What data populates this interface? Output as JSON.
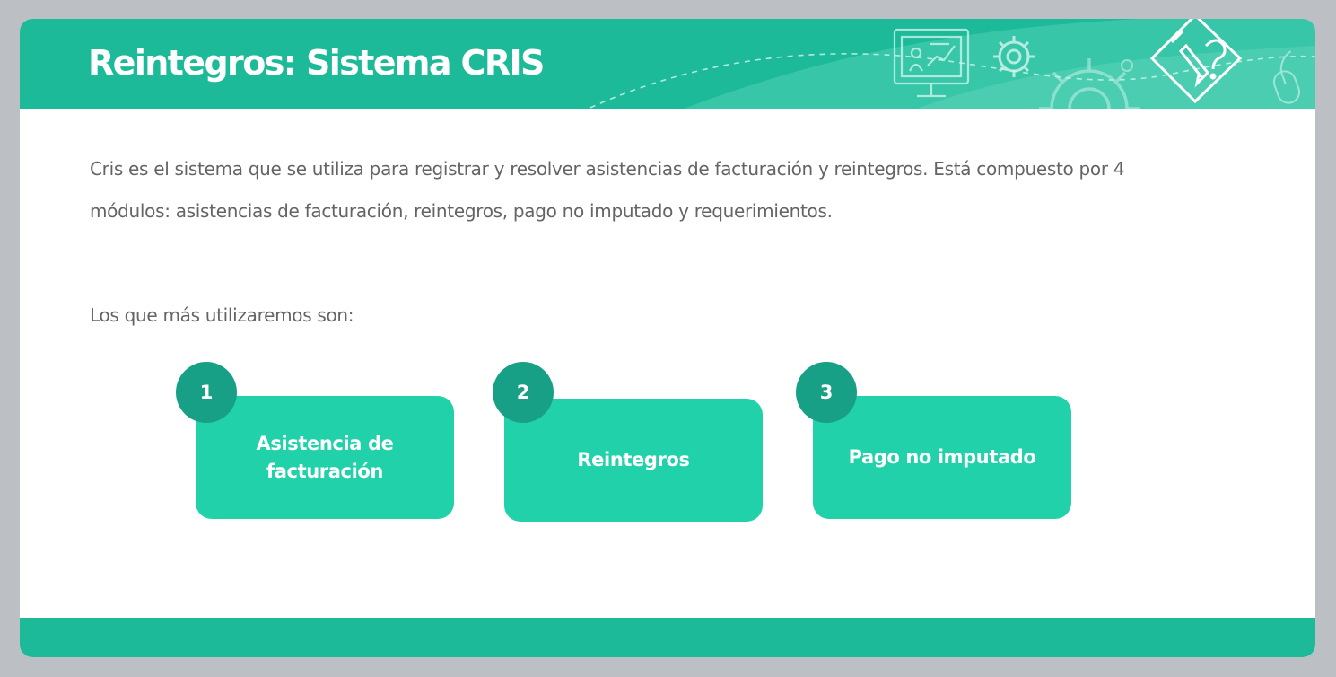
{
  "header": {
    "title": "Reintegros: Sistema CRIS"
  },
  "main": {
    "intro": "Cris es el sistema que se utiliza para registrar y resolver asistencias de facturación y reintegros. Está compuesto por 4 módulos: asistencias de facturación, reintegros, pago no imputado y requerimientos.",
    "subheading": "Los que más utilizaremos son:",
    "modules": [
      {
        "number": "1",
        "label": "Asistencia de facturación"
      },
      {
        "number": "2",
        "label": "Reintegros"
      },
      {
        "number": "3",
        "label": "Pago no imputado"
      }
    ]
  },
  "colors": {
    "background": "#bcc0c4",
    "header": "#1dba99",
    "module_box": "#20d1aa",
    "badge": "#17a085",
    "body_text": "#646464"
  },
  "icons": [
    "presentation-board-icon",
    "gear-icon",
    "large-gear-icon",
    "edit-diamond-icon",
    "mouse-icon"
  ]
}
